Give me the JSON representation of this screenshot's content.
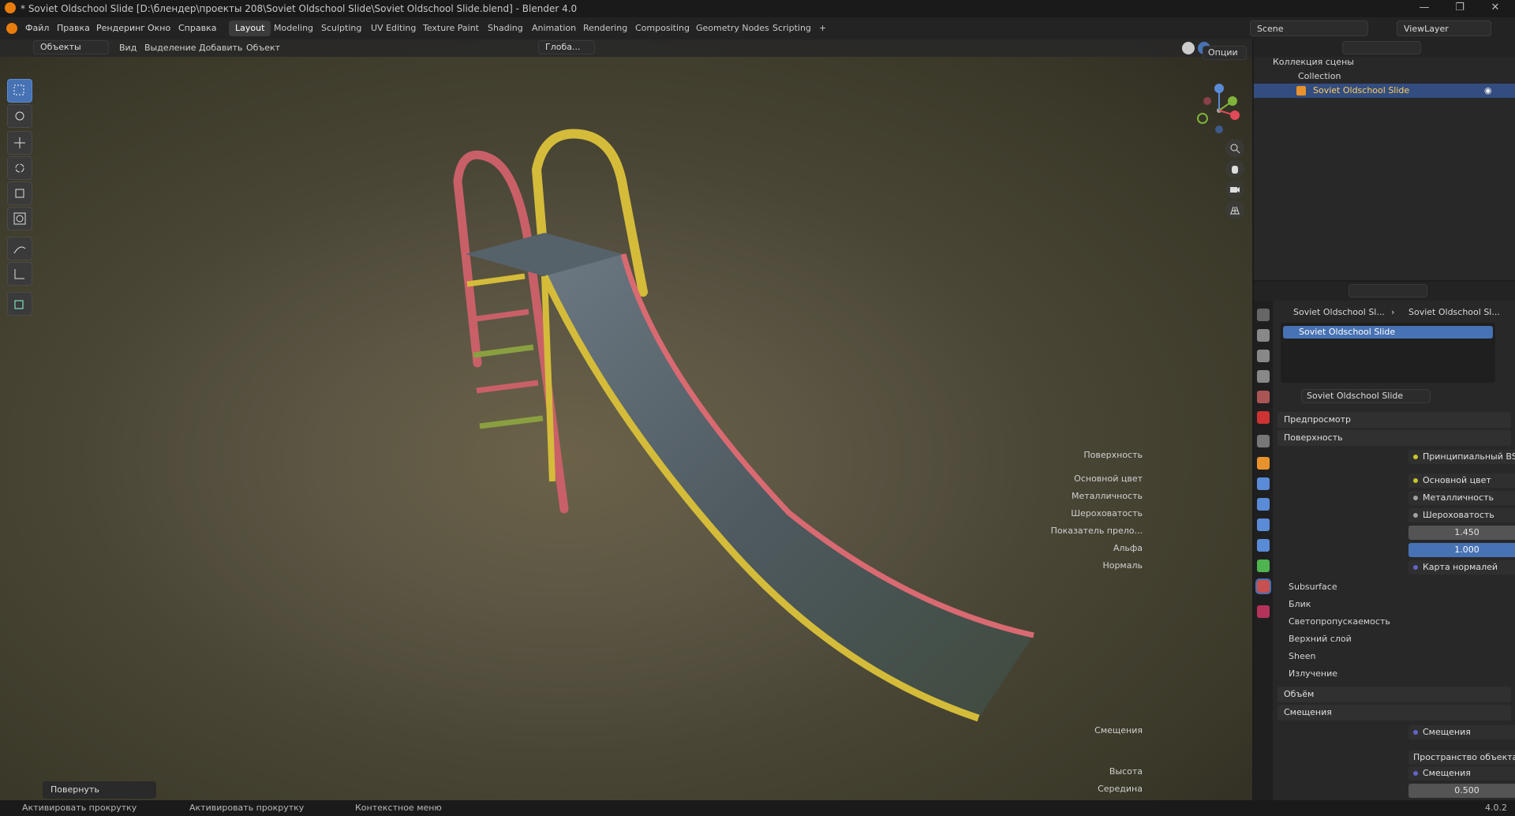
{
  "window": {
    "title": "* Soviet Oldschool Slide [D:\\блендер\\проекты 208\\Soviet Oldschool Slide\\Soviet Oldschool Slide.blend] - Blender 4.0",
    "minimize": "—",
    "maximize": "❐",
    "close": "✕"
  },
  "menu": [
    "Файл",
    "Правка",
    "Рендеринг",
    "Окно",
    "Справка"
  ],
  "workspaces": [
    "Layout",
    "Modeling",
    "Sculpting",
    "UV Editing",
    "Texture Paint",
    "Shading",
    "Animation",
    "Rendering",
    "Compositing",
    "Geometry Nodes",
    "Scripting",
    "+"
  ],
  "scene": {
    "name": "Scene",
    "view_layer": "ViewLayer"
  },
  "viewport_header": {
    "mode": "Объекты",
    "menus": [
      "Вид",
      "Выделение",
      "Добавить",
      "Объект"
    ],
    "orientation": "Глоба...",
    "options": "Опции"
  },
  "rotate_panel": "Повернуть",
  "outliner": {
    "root": "Коллекция сцены",
    "collection": "Collection",
    "object": "Soviet Oldschool Slide"
  },
  "properties": {
    "breadcrumb": [
      "Soviet Oldschool Sl...",
      "Soviet Oldschool Sl..."
    ],
    "slot": "Soviet Oldschool Slide",
    "material": "Soviet Oldschool Slide",
    "sections": {
      "preview": "Предпросмотр",
      "surface": "Поверхность",
      "volume": "Объём",
      "displacement": "Смещения"
    },
    "surface_rows": [
      {
        "label": "Поверхность",
        "value": "Принципиальный BSDF"
      },
      {
        "label": "Основной цвет",
        "value": "Основной цвет"
      },
      {
        "label": "Металличность",
        "value": "Металличность"
      },
      {
        "label": "Шероховатость",
        "value": "Шероховатость"
      },
      {
        "label": "Показатель прело...",
        "value": "1.450"
      },
      {
        "label": "Альфа",
        "value": "1.000"
      },
      {
        "label": "Нормаль",
        "value": "Карта нормалей"
      }
    ],
    "subsections": [
      "Subsurface",
      "Блик",
      "Светопропускаемость",
      "Верхний слой",
      "Sheen",
      "Излучение"
    ],
    "disp_rows": [
      {
        "label": "Смещения",
        "value": "Смещения"
      },
      {
        "label": "",
        "value": "Пространство объекта"
      },
      {
        "label": "Высота",
        "value": "Смещения"
      },
      {
        "label": "Середина",
        "value": "0.500"
      }
    ]
  },
  "status": {
    "left": "Активировать прокрутку",
    "mid": "Активировать прокрутку",
    "right": "Контекстное меню",
    "version": "4.0.2"
  },
  "colors": {
    "accent": "#4772b3",
    "slide_pink": "#d96a72",
    "slide_yellow": "#d4c13a",
    "metal": "#5a6670"
  }
}
